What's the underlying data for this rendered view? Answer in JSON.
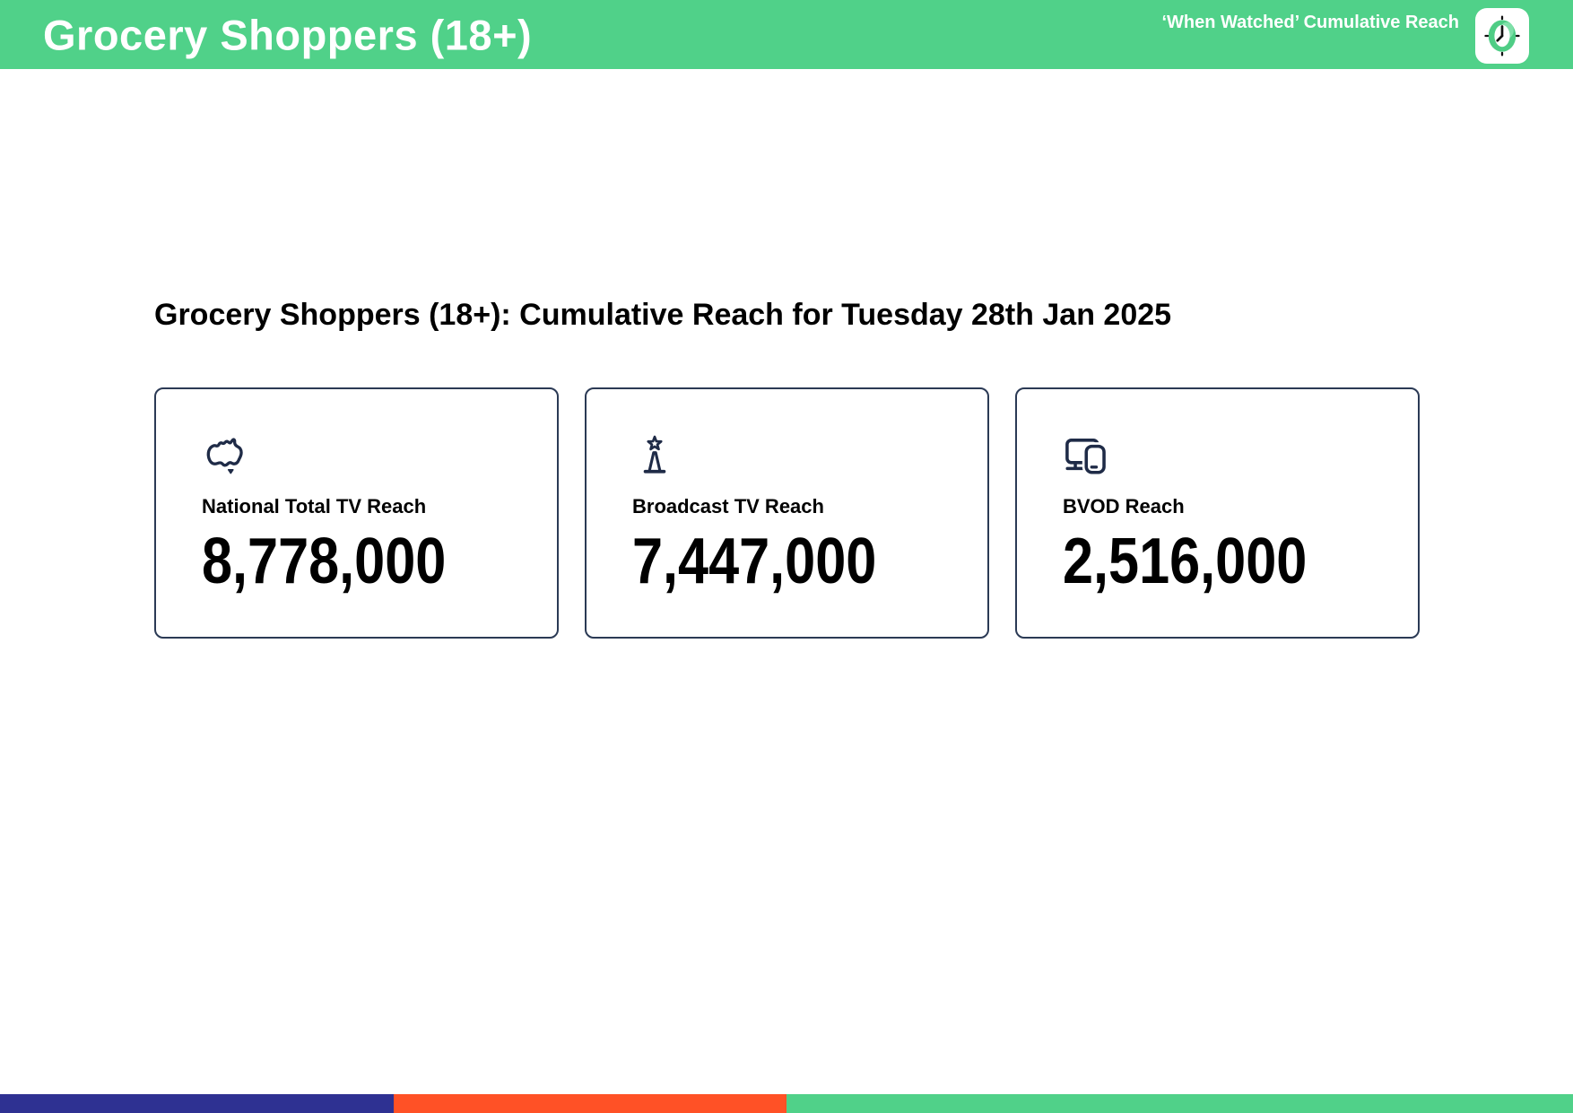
{
  "header": {
    "title": "Grocery Shoppers (18+)",
    "tagline": "‘When Watched’ Cumulative Reach",
    "logo_icon": "clock"
  },
  "content": {
    "heading": "Grocery Shoppers (18+): Cumulative Reach for Tuesday 28th Jan 2025",
    "cards": [
      {
        "icon": "australia-map",
        "label": "National Total TV Reach",
        "value": "8,778,000"
      },
      {
        "icon": "broadcast-tower",
        "label": "Broadcast TV Reach",
        "value": "7,447,000"
      },
      {
        "icon": "tv-and-phone-devices",
        "label": "BVOD Reach",
        "value": "2,516,000"
      }
    ]
  },
  "footer": {
    "segments": [
      {
        "name": "blue",
        "color": "#2E3192",
        "width_pct": 25
      },
      {
        "name": "orange",
        "color": "#FF5126",
        "width_pct": 25
      },
      {
        "name": "green",
        "color": "#50D189",
        "width_pct": 50
      }
    ]
  },
  "colors": {
    "header_bg": "#50D189",
    "icon_navy": "#1F2B47",
    "card_border": "#2B3A55",
    "text": "#000000"
  }
}
